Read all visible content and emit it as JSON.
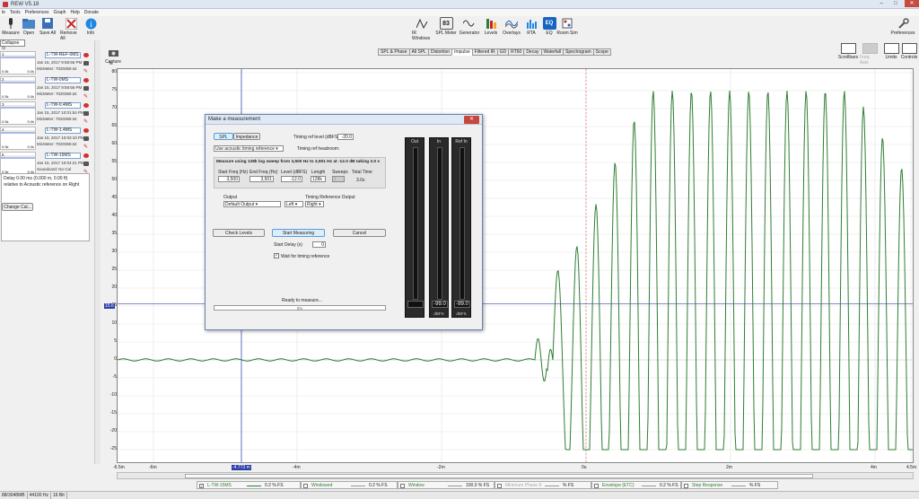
{
  "window": {
    "title": "REW V5.18"
  },
  "menu": [
    "le",
    "Tools",
    "Preferences",
    "Graph",
    "Help",
    "Donate"
  ],
  "toolbar": {
    "left": [
      "Measure",
      "Open",
      "Save All",
      "Remove All",
      "Info"
    ],
    "center": [
      "IR Windows",
      "SPL Meter",
      "Generator",
      "Levels",
      "Overlays",
      "RTA",
      "EQ",
      "Room Sim"
    ],
    "spl_value": "83",
    "right": "Preferences"
  },
  "sidebar": {
    "collapse": "Collapse",
    "measurements": [
      {
        "num": "1",
        "name": "L-TW-REF-0MS",
        "date": "Jan 15, 2017 9:58:56 PM",
        "mic": "MicMeter: 7020369.txt",
        "lo": "0.5k",
        "hi": "5.0k"
      },
      {
        "num": "2",
        "name": "L-TW-0MS",
        "date": "Jan 15, 2017 9:59:56 PM",
        "mic": "MicMeter: 7020369.txt",
        "lo": "0.5k",
        "hi": "5.0k"
      },
      {
        "num": "3",
        "name": "L-TW-0.4MS",
        "date": "Jan 15, 2017 10:01:54 PM",
        "mic": "MicMeter: 7020369.txt",
        "lo": "0.5k",
        "hi": "5.0k"
      },
      {
        "num": "4",
        "name": "L-TW-1.4MS",
        "date": "Jan 15, 2017 10:03:10 PM",
        "mic": "MicMeter: 7020369.txt",
        "lo": "0.5k",
        "hi": "5.0k"
      },
      {
        "num": "5",
        "name": "L-TW-15MS",
        "date": "Jan 15, 2017 10:04:21 PM",
        "mic": "Soundcard: No Cal",
        "lo": "0.5k",
        "hi": "5.0k"
      }
    ],
    "info": [
      "Delay 0.00 ms (0.000 m, 0.00 ft)",
      "relative to Acoustic reference on Right"
    ],
    "change_cal": "Change Cal..."
  },
  "capture": "Capture",
  "tabs": [
    "SPL & Phase",
    "All SPL",
    "Distortion",
    "Impulse",
    "Filtered IR",
    "GD",
    "RT60",
    "Decay",
    "Waterfall",
    "Spectrogram",
    "Scope"
  ],
  "active_tab": "Impulse",
  "right_tools": [
    "Scrollbars",
    "Freq. Axis",
    "Limits",
    "Controls"
  ],
  "chart_data": {
    "type": "line",
    "ylabel": "%",
    "ylim": [
      -25,
      80
    ],
    "yticks": [
      80,
      75,
      70,
      65,
      60,
      55,
      50,
      45,
      40,
      35,
      30,
      25,
      20,
      15,
      10,
      5,
      0,
      -5,
      -10,
      -15,
      -20,
      -25
    ],
    "xlim": [
      -6.5,
      4.5
    ],
    "xticks": [
      "-6.5m",
      "-6m",
      "-4m",
      "-2m",
      "0u",
      "2m",
      "4m",
      "4.5m"
    ],
    "cursor_x_label": "-4.773 m",
    "cursor_y_label": "15.6",
    "series": [
      {
        "name": "L-TW-15MS",
        "color": "#2e7d32"
      }
    ]
  },
  "legend": [
    {
      "name": "L-TW-15MS",
      "value": "0.2 % FS"
    },
    {
      "name": "Windowed",
      "value": "0.2 % FS"
    },
    {
      "name": "Window",
      "value": "100.0 % FS"
    },
    {
      "name": "Minimum Phase IR",
      "value": "% FS"
    },
    {
      "name": "Envelope (ETC)",
      "value": "0.2 % FS"
    },
    {
      "name": "Step Response",
      "value": "% FS"
    }
  ],
  "status": [
    "88/3048MB",
    "44100 Hz",
    "16 Bit"
  ],
  "dialog": {
    "title": "Make a measurement",
    "tab_spl": "SPL",
    "tab_imp": "Impedance",
    "timing_ref_label": "Timing ref level (dBFS):",
    "timing_ref_value": "-20.0",
    "headroom_label": "Timing ref headroom:",
    "acoustic_ref": "Use acoustic timing reference",
    "summary": "Measure using 128k log sweep from 3,500 Hz to 3,501 Hz at -12.0 dB taking 3.0 s",
    "start_freq_label": "Start Freq (Hz)",
    "start_freq": "3,500",
    "end_freq_label": "End Freq (Hz)",
    "end_freq": "3,501",
    "level_label": "Level (dBFS)",
    "level": "-12.0",
    "length_label": "Length",
    "length": "128k",
    "sweeps_label": "Sweeps",
    "sweeps": "1",
    "total_label": "Total Time",
    "total": "3.0s",
    "output_label": "Output",
    "output": "Default Output",
    "output_ch": "Left",
    "timing_out_label": "Timing Reference Output",
    "timing_out": "Right",
    "check_levels": "Check Levels",
    "start_measuring": "Start Measuring",
    "cancel": "Cancel",
    "start_delay_label": "Start Delay (s)",
    "start_delay": "0",
    "wait_label": "Wait for timing reference",
    "status": "Ready to measure...",
    "progress": "0%",
    "meters": [
      {
        "title": "Out",
        "value": "",
        "unit": ""
      },
      {
        "title": "In",
        "value": "-99.0",
        "unit": "dBFS"
      },
      {
        "title": "Ref In",
        "value": "-99.0",
        "unit": "dBFS"
      }
    ]
  }
}
